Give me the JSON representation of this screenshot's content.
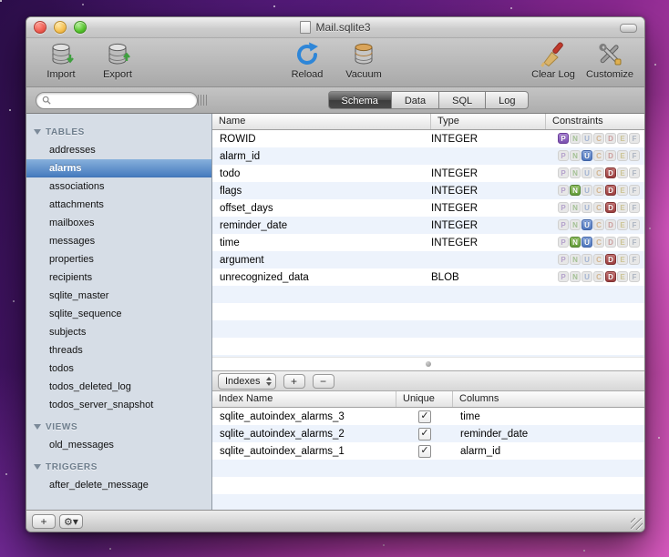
{
  "window": {
    "title": "Mail.sqlite3"
  },
  "toolbar": {
    "items": [
      {
        "label": "Import",
        "icon": "database-import-icon"
      },
      {
        "label": "Export",
        "icon": "database-export-icon"
      },
      {
        "label": "Reload",
        "icon": "reload-arrow-icon"
      },
      {
        "label": "Vacuum",
        "icon": "vacuum-database-icon"
      },
      {
        "label": "Clear Log",
        "icon": "clear-log-brush-icon"
      },
      {
        "label": "Customize",
        "icon": "customize-tools-icon"
      }
    ]
  },
  "search": {
    "value": "",
    "placeholder": ""
  },
  "tabs": [
    {
      "label": "Schema",
      "selected": true
    },
    {
      "label": "Data",
      "selected": false
    },
    {
      "label": "SQL",
      "selected": false
    },
    {
      "label": "Log",
      "selected": false
    }
  ],
  "sidebar": {
    "selected": "alarms",
    "sections": [
      {
        "title": "TABLES",
        "items": [
          "addresses",
          "alarms",
          "associations",
          "attachments",
          "mailboxes",
          "messages",
          "properties",
          "recipients",
          "sqlite_master",
          "sqlite_sequence",
          "subjects",
          "threads",
          "todos",
          "todos_deleted_log",
          "todos_server_snapshot"
        ]
      },
      {
        "title": "VIEWS",
        "items": [
          "old_messages"
        ]
      },
      {
        "title": "TRIGGERS",
        "items": [
          "after_delete_message"
        ]
      }
    ]
  },
  "schema_table": {
    "columns": [
      "Name",
      "Type",
      "Constraints"
    ],
    "badge_letters": [
      "P",
      "N",
      "U",
      "C",
      "D",
      "E",
      "F"
    ],
    "rows": [
      {
        "name": "ROWID",
        "type": "INTEGER",
        "active": [
          "P"
        ]
      },
      {
        "name": "alarm_id",
        "type": "",
        "active": [
          "U"
        ]
      },
      {
        "name": "todo",
        "type": "INTEGER",
        "active": [
          "D"
        ]
      },
      {
        "name": "flags",
        "type": "INTEGER",
        "active": [
          "N",
          "D"
        ]
      },
      {
        "name": "offset_days",
        "type": "INTEGER",
        "active": [
          "D"
        ]
      },
      {
        "name": "reminder_date",
        "type": "INTEGER",
        "active": [
          "U"
        ]
      },
      {
        "name": "time",
        "type": "INTEGER",
        "active": [
          "N",
          "U"
        ]
      },
      {
        "name": "argument",
        "type": "",
        "active": [
          "D"
        ]
      },
      {
        "name": "unrecognized_data",
        "type": "BLOB",
        "active": [
          "D"
        ]
      }
    ]
  },
  "index_pane": {
    "selector_label": "Indexes",
    "add_label": "+",
    "remove_label": "−",
    "columns": [
      "Index Name",
      "Unique",
      "Columns"
    ],
    "check_glyph": "✓",
    "rows": [
      {
        "name": "sqlite_autoindex_alarms_3",
        "unique": true,
        "columns": "time"
      },
      {
        "name": "sqlite_autoindex_alarms_2",
        "unique": true,
        "columns": "reminder_date"
      },
      {
        "name": "sqlite_autoindex_alarms_1",
        "unique": true,
        "columns": "alarm_id"
      }
    ]
  },
  "bottom_bar": {
    "add_label": "+",
    "gear_glyph": "⚙",
    "dropdown_glyph": "▾"
  },
  "colors": {
    "selection_blue": "#4a7ec0",
    "row_stripe": "#edf3fc",
    "badge_primary": "#7a4fae",
    "badge_notnull": "#639b3a",
    "badge_unique": "#4f77bd",
    "badge_default": "#9b3f3f"
  }
}
